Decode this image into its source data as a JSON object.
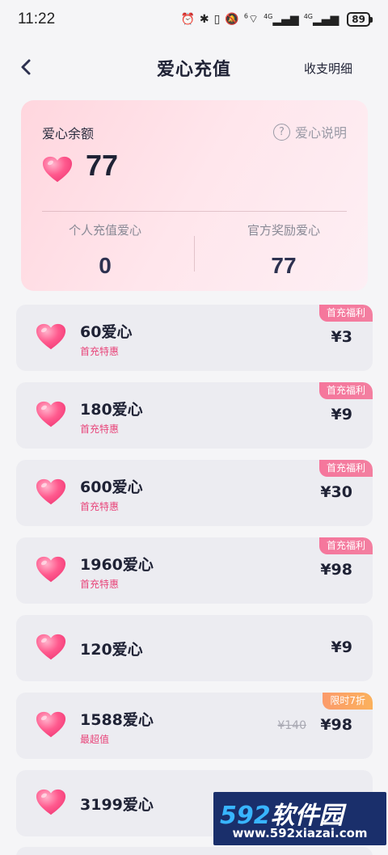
{
  "status_bar": {
    "time": "11:22",
    "battery": "89",
    "network_1": "4G",
    "network_2": "4G",
    "wifi_badge": "6"
  },
  "nav": {
    "title": "爱心充值",
    "detail_link": "收支明细"
  },
  "balance": {
    "label": "爱心余额",
    "help_label": "爱心说明",
    "amount": "77",
    "personal_label": "个人充值爱心",
    "personal_value": "0",
    "reward_label": "官方奖励爱心",
    "reward_value": "77"
  },
  "packages": [
    {
      "name": "60爱心",
      "sub": "首充特惠",
      "price": "¥3",
      "badge": "首充福利",
      "badge_style": "pink"
    },
    {
      "name": "180爱心",
      "sub": "首充特惠",
      "price": "¥9",
      "badge": "首充福利",
      "badge_style": "pink"
    },
    {
      "name": "600爱心",
      "sub": "首充特惠",
      "price": "¥30",
      "badge": "首充福利",
      "badge_style": "pink"
    },
    {
      "name": "1960爱心",
      "sub": "首充特惠",
      "price": "¥98",
      "badge": "首充福利",
      "badge_style": "pink"
    },
    {
      "name": "120爱心",
      "sub": "",
      "price": "¥9",
      "badge": "",
      "badge_style": ""
    },
    {
      "name": "1588爱心",
      "sub": "最超值",
      "price": "¥98",
      "old_price": "¥140",
      "badge": "限时7折",
      "badge_style": "orange"
    },
    {
      "name": "3199爱心",
      "sub": "",
      "price": "",
      "badge": "",
      "badge_style": ""
    }
  ],
  "watermark": {
    "text_num": "592",
    "text_cn": "软件园",
    "url": "www.592xiazai.com"
  },
  "colors": {
    "accent_pink": "#e8457a",
    "heart": "#ff4f86",
    "badge_pink": "#f5769c",
    "badge_orange": "#fbb15c",
    "watermark_bg": "#1a2f6b"
  }
}
